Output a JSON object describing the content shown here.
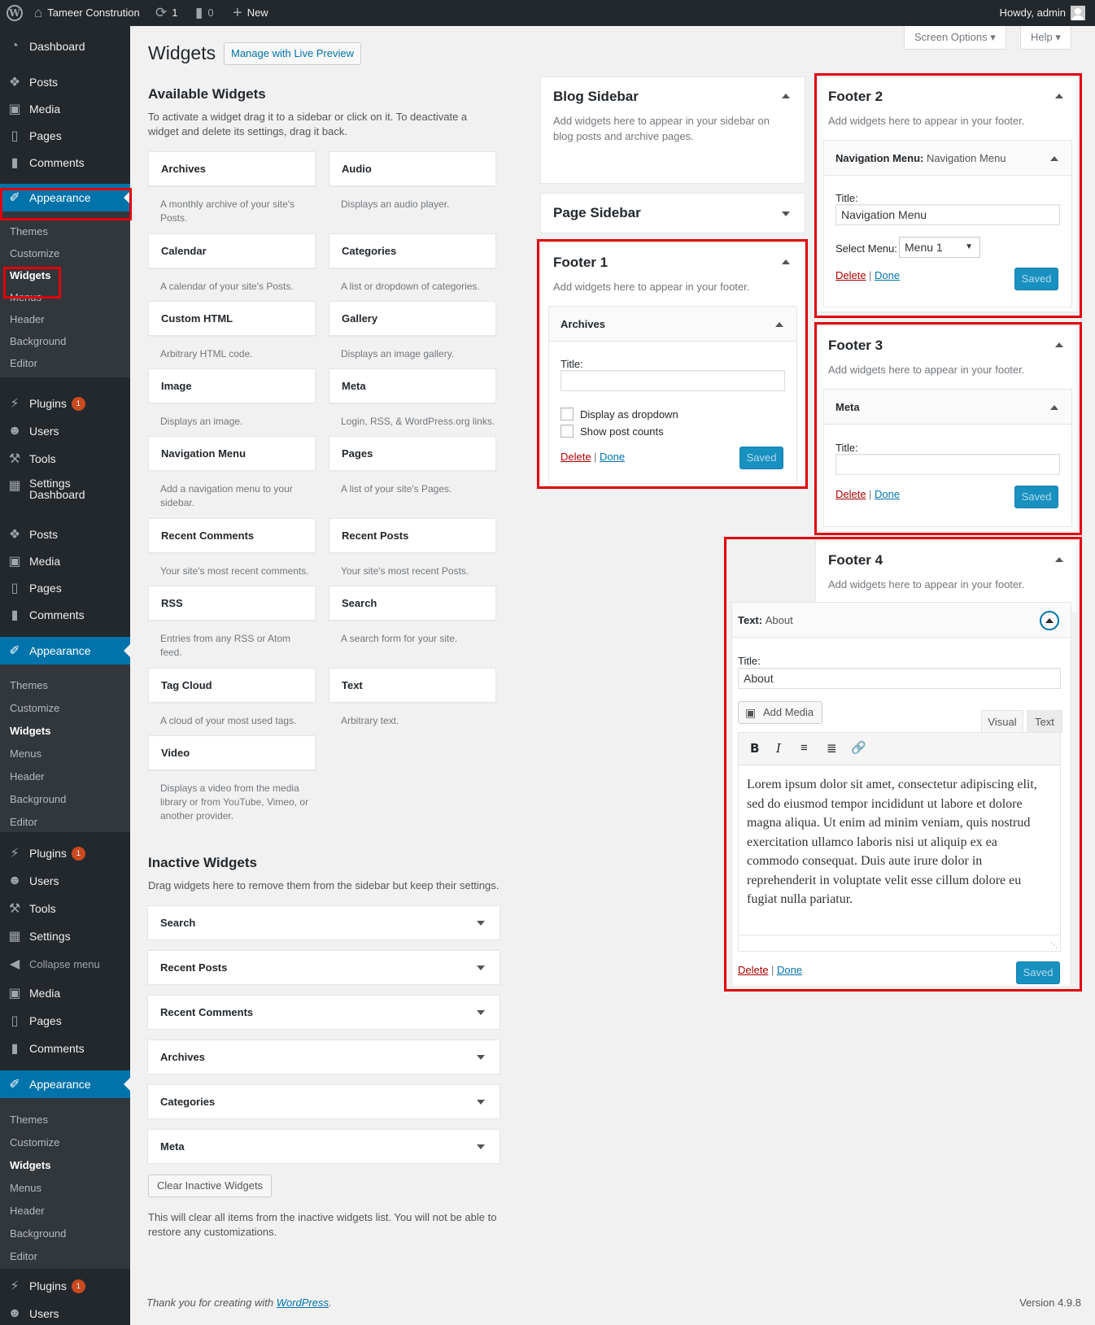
{
  "adminbar": {
    "site_name": "Tameer Constrution",
    "updates_count": "1",
    "comments_count": "0",
    "new_label": "New",
    "howdy": "Howdy, admin"
  },
  "sidebar": {
    "groups": [
      {
        "dashboard": "Dashboard"
      },
      {
        "posts": "Posts",
        "media": "Media",
        "pages": "Pages",
        "comments": "Comments",
        "appearance": "Appearance",
        "themes": "Themes",
        "customize": "Customize",
        "widgets": "Widgets",
        "menus": "Menus",
        "header": "Header",
        "background": "Background",
        "editor": "Editor",
        "plugins": "Plugins",
        "plugins_badge": "1",
        "users": "Users",
        "tools": "Tools",
        "settings": "Settings",
        "dashboard2": "Dashboard"
      },
      {
        "posts": "Posts",
        "media": "Media",
        "pages": "Pages",
        "comments": "Comments",
        "appearance": "Appearance",
        "themes": "Themes",
        "customize": "Customize",
        "widgets": "Widgets",
        "menus": "Menus",
        "header": "Header",
        "background": "Background",
        "editor": "Editor",
        "plugins": "Plugins",
        "plugins_badge": "1",
        "users": "Users",
        "tools": "Tools",
        "settings": "Settings",
        "collapse": "Collapse menu"
      },
      {
        "media": "Media",
        "pages": "Pages",
        "comments": "Comments",
        "appearance": "Appearance",
        "themes": "Themes",
        "customize": "Customize",
        "widgets": "Widgets",
        "menus": "Menus",
        "header": "Header",
        "background": "Background",
        "editor": "Editor",
        "plugins": "Plugins",
        "plugins_badge": "1",
        "users": "Users"
      }
    ]
  },
  "header": {
    "title": "Widgets",
    "live_preview": "Manage with Live Preview",
    "screen_options": "Screen Options",
    "help": "Help"
  },
  "available": {
    "heading": "Available Widgets",
    "description": "To activate a widget drag it to a sidebar or click on it. To deactivate a widget and delete its settings, drag it back.",
    "widgets": [
      {
        "name": "Archives",
        "desc": "A monthly archive of your site's Posts."
      },
      {
        "name": "Audio",
        "desc": "Displays an audio player."
      },
      {
        "name": "Calendar",
        "desc": "A calendar of your site's Posts."
      },
      {
        "name": "Categories",
        "desc": "A list or dropdown of categories."
      },
      {
        "name": "Custom HTML",
        "desc": "Arbitrary HTML code."
      },
      {
        "name": "Gallery",
        "desc": "Displays an image gallery."
      },
      {
        "name": "Image",
        "desc": "Displays an image."
      },
      {
        "name": "Meta",
        "desc": "Login, RSS, & WordPress.org links."
      },
      {
        "name": "Navigation Menu",
        "desc": "Add a navigation menu to your sidebar."
      },
      {
        "name": "Pages",
        "desc": "A list of your site's Pages."
      },
      {
        "name": "Recent Comments",
        "desc": "Your site's most recent comments."
      },
      {
        "name": "Recent Posts",
        "desc": "Your site's most recent Posts."
      },
      {
        "name": "RSS",
        "desc": "Entries from any RSS or Atom feed."
      },
      {
        "name": "Search",
        "desc": "A search form for your site."
      },
      {
        "name": "Tag Cloud",
        "desc": "A cloud of your most used tags."
      },
      {
        "name": "Text",
        "desc": "Arbitrary text."
      },
      {
        "name": "Video",
        "desc": "Displays a video from the media library or from YouTube, Vimeo, or another provider."
      }
    ]
  },
  "inactive": {
    "heading": "Inactive Widgets",
    "description": "Drag widgets here to remove them from the sidebar but keep their settings.",
    "widgets": [
      "Search",
      "Recent Posts",
      "Recent Comments",
      "Archives",
      "Categories",
      "Meta"
    ],
    "clear_button": "Clear Inactive Widgets",
    "clear_note": "This will clear all items from the inactive widgets list. You will not be able to restore any customizations."
  },
  "blog_sidebar": {
    "title": "Blog Sidebar",
    "desc": "Add widgets here to appear in your sidebar on blog posts and archive pages."
  },
  "page_sidebar": {
    "title": "Page Sidebar"
  },
  "footer1": {
    "title": "Footer 1",
    "desc": "Add widgets here to appear in your footer.",
    "widget": {
      "name": "Archives",
      "title_label": "Title:",
      "title_value": "",
      "opt1": "Display as dropdown",
      "opt2": "Show post counts",
      "delete": "Delete",
      "done": "Done",
      "saved": "Saved"
    }
  },
  "footer2": {
    "title": "Footer 2",
    "desc": "Add widgets here to appear in your footer.",
    "widget": {
      "name": "Navigation Menu:",
      "instance": "Navigation Menu",
      "title_label": "Title:",
      "title_value": "Navigation Menu",
      "select_label": "Select Menu:",
      "select_value": "Menu 1",
      "delete": "Delete",
      "done": "Done",
      "saved": "Saved"
    }
  },
  "footer3": {
    "title": "Footer 3",
    "desc": "Add widgets here to appear in your footer.",
    "widget": {
      "name": "Meta",
      "title_label": "Title:",
      "title_value": "",
      "delete": "Delete",
      "done": "Done",
      "saved": "Saved"
    }
  },
  "footer4": {
    "title": "Footer 4",
    "desc": "Add widgets here to appear in your footer.",
    "widget": {
      "name": "Text:",
      "instance": "About",
      "title_label": "Title:",
      "title_value": "About",
      "add_media": "Add Media",
      "tab_visual": "Visual",
      "tab_text": "Text",
      "content": "Lorem ipsum dolor sit amet, consectetur adipiscing elit, sed do eiusmod tempor incididunt ut labore et dolore magna aliqua. Ut enim ad minim veniam, quis nostrud exercitation ullamco laboris nisi ut aliquip ex ea commodo consequat. Duis aute irure dolor in reprehenderit in voluptate velit esse cillum dolore eu fugiat nulla pariatur.",
      "delete": "Delete",
      "done": "Done",
      "saved": "Saved"
    }
  },
  "footer": {
    "thanks": "Thank you for creating with ",
    "wp_link": "WordPress",
    "period": ".",
    "version": "Version 4.9.8"
  },
  "colors": {
    "accent": "#0073aa",
    "highlight": "#e0000a",
    "menu_bg": "#23282d"
  }
}
